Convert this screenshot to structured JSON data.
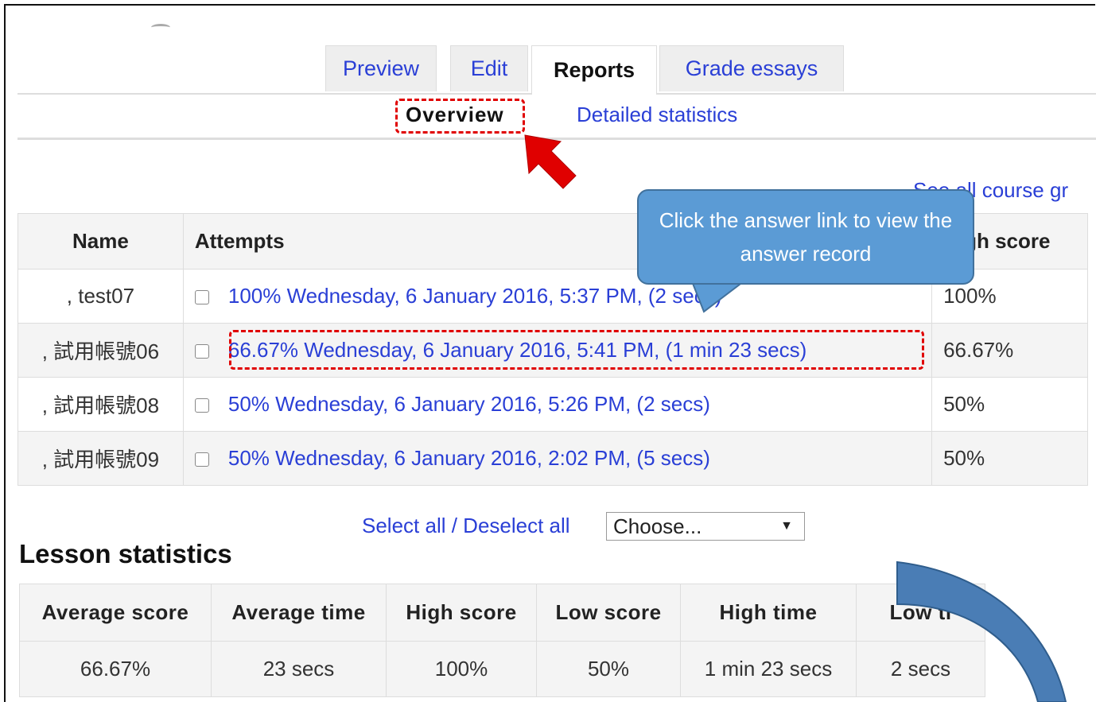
{
  "tabs": {
    "preview": "Preview",
    "edit": "Edit",
    "reports": "Reports",
    "grade_essays": "Grade essays"
  },
  "subtabs": {
    "overview": "Overview",
    "detailed_statistics": "Detailed statistics"
  },
  "see_all_link": "See all course gr",
  "attempts_table": {
    "headers": {
      "name": "Name",
      "attempts": "Attempts",
      "high_score": "High score"
    },
    "rows": [
      {
        "name": ", test07",
        "attempt": "100% Wednesday, 6 January 2016, 5:37 PM, (2 secs)",
        "high_score": "100%"
      },
      {
        "name": ", 試用帳號06",
        "attempt": "66.67% Wednesday, 6 January 2016, 5:41 PM, (1 min 23 secs)",
        "high_score": "66.67%"
      },
      {
        "name": ", 試用帳號08",
        "attempt": "50% Wednesday, 6 January 2016, 5:26 PM, (2 secs)",
        "high_score": "50%"
      },
      {
        "name": ", 試用帳號09",
        "attempt": "50% Wednesday, 6 January 2016, 2:02 PM, (5 secs)",
        "high_score": "50%"
      }
    ]
  },
  "selection": {
    "select_all": "Select all",
    "separator": " / ",
    "deselect_all": "Deselect all",
    "dropdown_value": "Choose..."
  },
  "lesson_statistics": {
    "heading": "Lesson statistics",
    "headers": [
      "Average score",
      "Average time",
      "High score",
      "Low score",
      "High time",
      "Low ti"
    ],
    "values": [
      "66.67%",
      "23 secs",
      "100%",
      "50%",
      "1 min 23 secs",
      "2 secs"
    ]
  },
  "annotation": {
    "callout_text": "Click the answer link to view the answer record",
    "colors": {
      "callout_fill": "#5b9bd5",
      "highlight": "#e00000",
      "curved_arrow": "#4a7db5"
    }
  }
}
